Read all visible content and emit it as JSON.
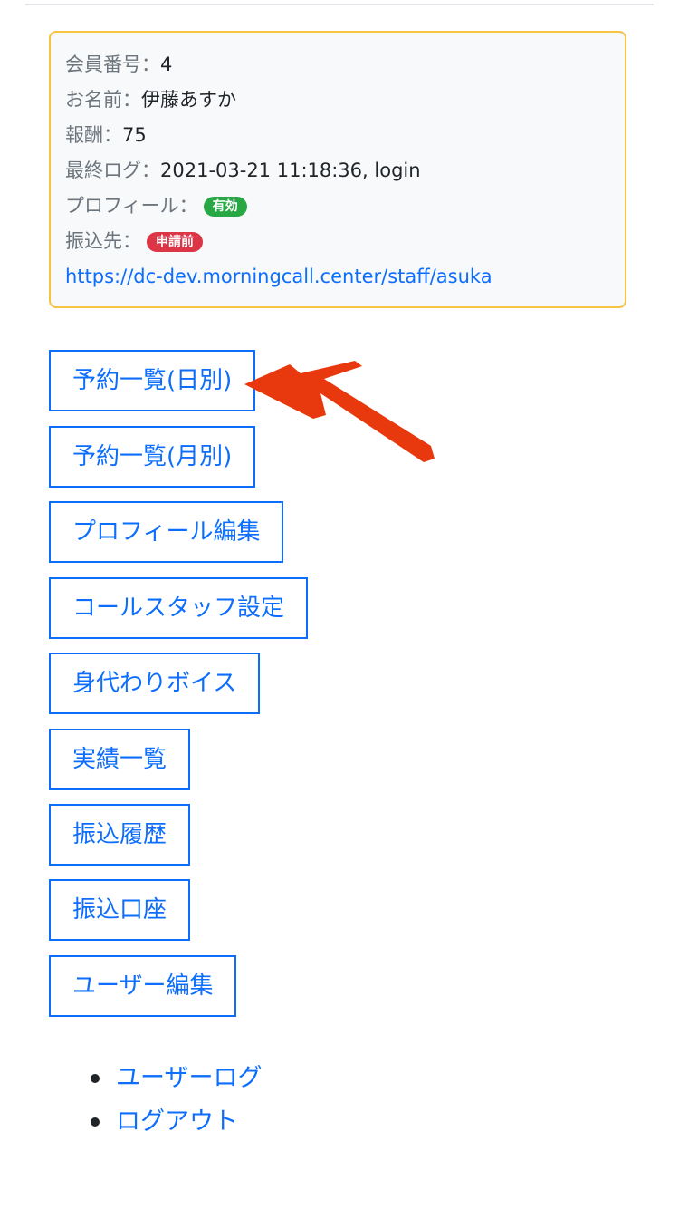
{
  "member": {
    "number_label": "会員番号：",
    "number_value": "4",
    "name_label": "お名前：",
    "name_value": "伊藤あすか",
    "reward_label": "報酬：",
    "reward_value": "75",
    "last_log_label": "最終ログ：",
    "last_log_value": "2021-03-21 11:18:36, login",
    "profile_label": "プロフィール：",
    "profile_badge": "有効",
    "transfer_label": "振込先：",
    "transfer_badge": "申請前",
    "url": "https://dc-dev.morningcall.center/staff/asuka"
  },
  "menu": [
    {
      "label": "予約一覧(日別)"
    },
    {
      "label": "予約一覧(月別)"
    },
    {
      "label": "プロフィール編集"
    },
    {
      "label": "コールスタッフ設定"
    },
    {
      "label": "身代わりボイス"
    },
    {
      "label": "実績一覧"
    },
    {
      "label": "振込履歴"
    },
    {
      "label": "振込口座"
    },
    {
      "label": "ユーザー編集"
    }
  ],
  "links": [
    {
      "label": "ユーザーログ"
    },
    {
      "label": "ログアウト"
    }
  ],
  "colors": {
    "primary": "#0d6efd",
    "card_border": "#f6c343",
    "badge_success": "#28a745",
    "badge_danger": "#dc3545",
    "annotation_arrow": "#e8380d"
  }
}
